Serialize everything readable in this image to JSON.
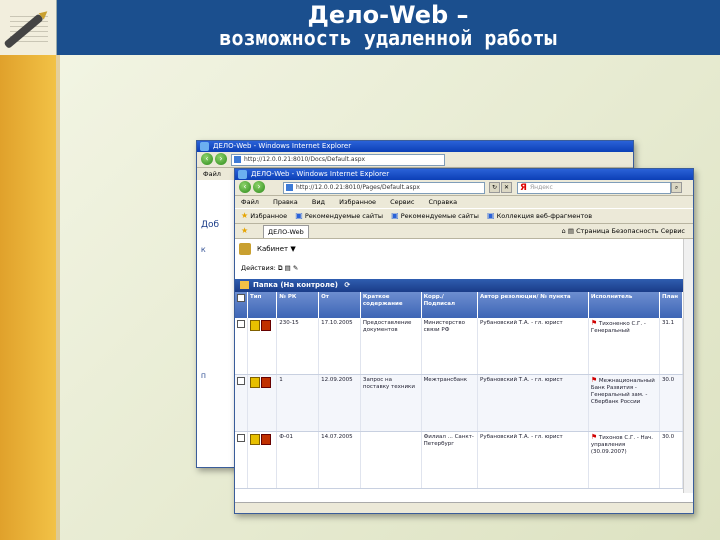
{
  "slide": {
    "title_line1": "Дело-Web –",
    "title_line2": "возможность удаленной работы"
  },
  "back_window": {
    "title": "ДЕЛО-Web - Windows Internet Explorer",
    "address": "http://12.0.0.21:8010/Docs/Default.aspx",
    "menu": [
      "Файл",
      "Пр"
    ],
    "left_texts": [
      "Доб",
      "К",
      "П"
    ]
  },
  "front_window": {
    "title": "ДЕЛО-Web - Windows Internet Explorer",
    "address": "http://12.0.0.21:8010/Pages/Default.aspx",
    "search_placeholder": "Яндекс",
    "menu": [
      "Файл",
      "Правка",
      "Вид",
      "Избранное",
      "Сервис",
      "Справка"
    ],
    "favorites": [
      "Избранное",
      "Рекомендуемые сайты",
      "Рекомендуемые сайты",
      "Коллекция веб-фрагментов"
    ],
    "tab_label": "ДЕЛО-Web",
    "page_tools": [
      "Страница",
      "Безопасность",
      "Сервис"
    ],
    "module_label": "Кабинет",
    "actions_label": "Действия:",
    "folder_title": "Папка (На контроле)",
    "columns": [
      "Тип",
      "№ РК",
      "От",
      "Краткое содержание",
      "Корр./ Подписал",
      "Автор резолюции/ № пункта",
      "Исполнитель",
      "План"
    ],
    "rows": [
      {
        "rk": "230-15",
        "date": "17.10.2005",
        "summary": "Предоставление документов",
        "corr": "Министерство связи РФ",
        "author": "Рубановский Т.А. - гл. юрист",
        "executor": "Тихоненко С.Г. - Генеральный",
        "plan": "31.1"
      },
      {
        "rk": "1",
        "date": "12.09.2005",
        "summary": "Запрос на поставку техники",
        "corr": "Межтрансбанк",
        "author": "Рубановский Т.А. - гл. юрист",
        "executor": "Межнациональный Банк Развития - Генеральный зам. - Сбербанк России",
        "plan": "30.0"
      },
      {
        "rk": "Ф-01",
        "date": "14.07.2005",
        "summary": "",
        "corr": "Филиал ... Санкт-Петербург",
        "author": "Рубановский Т.А. - гл. юрист",
        "executor": "Тихонов С.Г. - Нач. управления (30.09.2007)",
        "plan": "30.0"
      }
    ]
  },
  "colors": {
    "title_bar": "#1b4f8e",
    "left_stripe": "#e0a12b",
    "grid_header": "#3d65b5",
    "xp_title": "#0c3fb6"
  }
}
